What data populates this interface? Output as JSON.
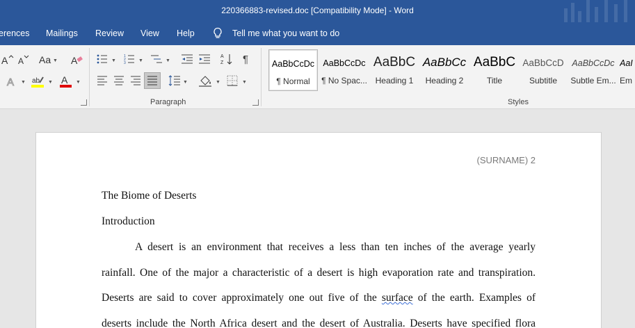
{
  "window": {
    "title": "220366883-revised.doc [Compatibility Mode]  -  Word"
  },
  "menu": {
    "tabs": [
      "erences",
      "Mailings",
      "Review",
      "View",
      "Help"
    ],
    "tell_me": "Tell me what you want to do"
  },
  "ribbon": {
    "font_group": {
      "change_case_label": "Aa"
    },
    "paragraph_group": {
      "label": "Paragraph"
    },
    "styles_group": {
      "label": "Styles",
      "items": [
        {
          "sample": "AaBbCcDc",
          "name": "¶ Normal"
        },
        {
          "sample": "AaBbCcDc",
          "name": "¶ No Spac..."
        },
        {
          "sample": "AaBbC",
          "name": "Heading 1"
        },
        {
          "sample": "AaBbCc",
          "name": "Heading 2"
        },
        {
          "sample": "AaBbC",
          "name": "Title"
        },
        {
          "sample": "AaBbCcD",
          "name": "Subtitle"
        },
        {
          "sample": "AaBbCcDc",
          "name": "Subtle Em..."
        },
        {
          "sample": "AaI",
          "name": "Em"
        }
      ]
    }
  },
  "document": {
    "header": "(SURNAME) 2",
    "title": "The Biome of Deserts",
    "heading": "Introduction",
    "lines": [
      "A desert is an environment that receives a less than ten inches of the average yearly",
      "rainfall. One of the major a characteristic of a desert is high evaporation rate and transpiration.",
      "Deserts are said to cover approximately one out five of the",
      "surface",
      "of the earth. Examples of",
      "deserts include the North Africa desert and the desert of Australia. Deserts have specified flora"
    ]
  },
  "colors": {
    "title_bar": "#2b579a",
    "ribbon": "#f3f3f3",
    "highlight_yellow": "#ffff00",
    "font_color_red": "#e00000"
  }
}
